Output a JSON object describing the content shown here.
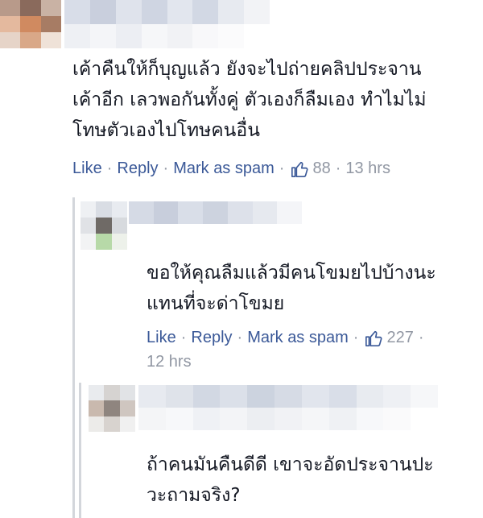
{
  "comments": [
    {
      "lines": [
        "เค้าคืนให้ก็บุญแล้ว ยังจะไปถ่ายคลิปประจาน",
        "เค้าอีก เลวพอกันทั้งคู่ ตัวเองก็ลืมเอง ทำไมไม่",
        "โทษตัวเองไปโทษคนอื่น"
      ],
      "like_label": "Like",
      "reply_label": "Reply",
      "spam_label": "Mark as spam",
      "like_count": "88",
      "time": "13 hrs"
    },
    {
      "lines": [
        "ขอให้คุณลืมแล้วมีคนโขมยไปบ้างนะ",
        "แทนที่จะด่าโขมย"
      ],
      "like_label": "Like",
      "reply_label": "Reply",
      "spam_label": "Mark as spam",
      "like_count": "227",
      "time": "12 hrs"
    },
    {
      "lines": [
        "ถ้าคนมันคืนดีดี เขาจะอัดประจานปะ",
        "วะถามจริง?"
      ]
    }
  ],
  "colors": {
    "link": "#3b5998",
    "meta": "#9197a3",
    "text": "#141823"
  },
  "icons": {
    "like": "thumbs-up-icon"
  }
}
